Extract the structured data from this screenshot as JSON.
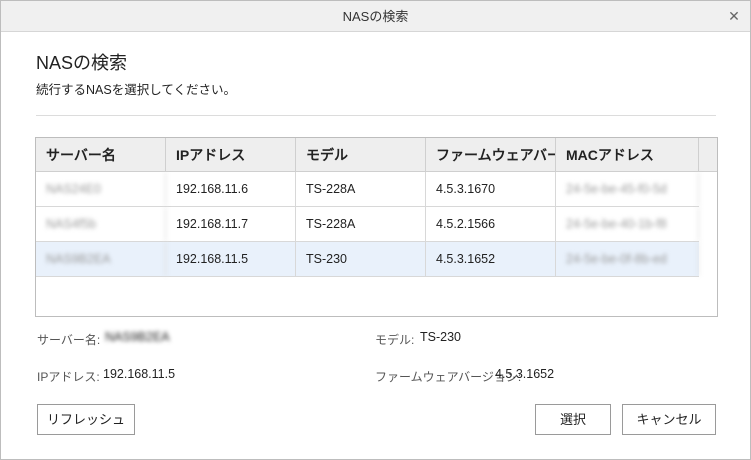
{
  "window": {
    "title": "NASの検索"
  },
  "header": {
    "title": "NASの検索",
    "subtitle": "続行するNASを選択してください。"
  },
  "table": {
    "columns": [
      "サーバー名",
      "IPアドレス",
      "モデル",
      "ファームウェアバージョン",
      "MACアドレス"
    ],
    "rows": [
      {
        "server": "NAS24E0",
        "ip": "192.168.11.6",
        "model": "TS-228A",
        "firmware": "4.5.3.1670",
        "mac": "24-5e-be-45-f0-5d",
        "selected": false
      },
      {
        "server": "NAS4f5b",
        "ip": "192.168.11.7",
        "model": "TS-228A",
        "firmware": "4.5.2.1566",
        "mac": "24-5e-be-40-1b-f8",
        "selected": false
      },
      {
        "server": "NAS9B2EA",
        "ip": "192.168.11.5",
        "model": "TS-230",
        "firmware": "4.5.3.1652",
        "mac": "24-5e-be-0f-8b-ed",
        "selected": true
      }
    ]
  },
  "details": {
    "server_label": "サーバー名:",
    "server_value": "NAS9B2EA",
    "ip_label": "IPアドレス:",
    "ip_value": "192.168.11.5",
    "model_label": "モデル:",
    "model_value": "TS-230",
    "firmware_label": "ファームウェアバージョン:",
    "firmware_value": "4.5.3.1652"
  },
  "buttons": {
    "refresh": "リフレッシュ",
    "select": "選択",
    "cancel": "キャンセル"
  },
  "icons": {
    "close": "close-icon"
  }
}
